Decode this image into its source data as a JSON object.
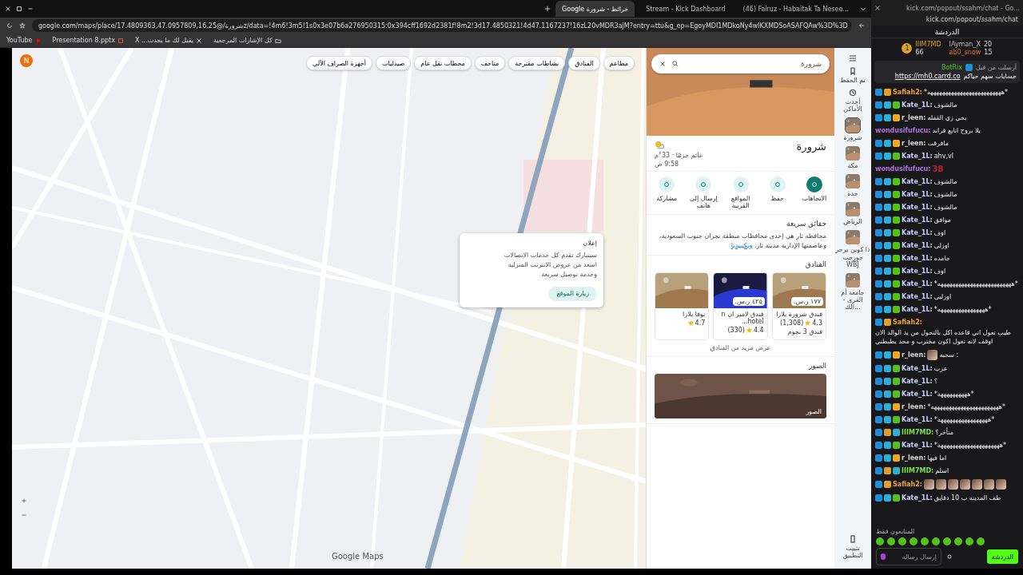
{
  "browser": {
    "active_tab": {
      "title": "Google خرائط - شرورة",
      "selected": true
    },
    "second_tab": {
      "title": "Stream - Kick Dashboard",
      "selected": false
    },
    "third_tab": {
      "title": "(46) Fairuz - Habaitak Ta Nesee...",
      "selected": false
    },
    "url": "google.com/maps/place/شرورة/@17.4809363,47.0957809,16.25z/data=!4m6!3m5!1s0x3e07b6a276950315:0x394cff1692d2381f!8m2!3d17.4850321!4d47.1167237!16zL20vMDR3ajM?entry=ttu&g_ep=EgoyMDI1MDkoNy4wIKXMDSoASAFQAw%3D%3D",
    "bookmarks": [
      {
        "title": "كل الإشارات المرجعية",
        "kind": "folder"
      },
      {
        "title": "يقبل لك ما يحدث... X",
        "kind": "x"
      },
      {
        "title": "Presentation 8.pptx",
        "kind": "ppt"
      },
      {
        "title": "YouTube",
        "kind": "yt"
      }
    ]
  },
  "map": {
    "avatar": "N",
    "chips": [
      {
        "label": "مطاعم"
      },
      {
        "label": "الفنادق"
      },
      {
        "label": "نشاطات مقترحة"
      },
      {
        "label": "متاحف"
      },
      {
        "label": "محطات نقل عام"
      },
      {
        "label": "صيدليات"
      },
      {
        "label": "أجهزة الصراف الآلي"
      }
    ],
    "ad": {
      "label": "إعلان",
      "lines": [
        "سيتبارك تقدم كل خدمات الاتصالات",
        "اسعد من عروض الانترنت المنزلية",
        "وخدمة توصيل سريعة"
      ],
      "button": "زيارة الموقع"
    },
    "logo": "Google Maps"
  },
  "panel": {
    "search": "شرورة",
    "title": "شرورة",
    "weather": {
      "condition": "غائم جزئيًا · 33°م",
      "time": "9:58 ص"
    },
    "actions": [
      {
        "label": "الاتجاهات",
        "selected": true
      },
      {
        "label": "حفظ",
        "selected": false
      },
      {
        "label": "المواقع القريبة",
        "selected": false
      },
      {
        "label": "إرسال إلى هاتف",
        "selected": false
      },
      {
        "label": "مشاركة",
        "selected": false
      }
    ],
    "facts": {
      "heading": "حقائق سريعة",
      "text": "محافظة ثار هي إحدى محافظات منطقة نجران جنوب السعودية، وعاصمتها الإدارية مدينة ثار.",
      "link": "ويكيبيديا"
    },
    "hotels": {
      "heading": "الفنادق",
      "items": [
        {
          "price": "١٧٧ ر.س.",
          "name": "فندق شرورة بلازا",
          "rating": "4.3",
          "reviews": "(1,308)",
          "class": "فندق 3 نجوم"
        },
        {
          "price": "٤٢٥ ر.س.",
          "name": "فندق لامير ان n hotel...",
          "rating": "4.4",
          "reviews": "(330)"
        },
        {
          "name": "نوفا بلازا",
          "rating": "4.7"
        }
      ],
      "more": "عرض مزيد من الفنادق"
    },
    "photos": {
      "heading": "الصور",
      "caption": "الصور"
    }
  },
  "rail": {
    "items": [
      {
        "kind": "saved",
        "label": "تم الحفظ"
      },
      {
        "kind": "recent",
        "label": "أحدث الأماكن"
      },
      {
        "kind": "thumb",
        "label": "شرورة",
        "selected": true
      },
      {
        "kind": "thumb",
        "label": "مكة",
        "selected": false
      },
      {
        "kind": "thumb",
        "label": "جدة",
        "selected": false
      },
      {
        "kind": "thumb",
        "label": "الرياض",
        "selected": false
      },
      {
        "kind": "thumb",
        "label": "ذا كوين برجر جورجت WBJ",
        "selected": false
      },
      {
        "kind": "thumb",
        "label": "جامعة أم القرى - الك...",
        "selected": false
      }
    ],
    "install": "تثبيت التطبيق"
  },
  "chat": {
    "window_title": "kick.com/popout/ssahm/chat - Go...",
    "url": "kick.com/popout/ssahm/chat",
    "header": "الدردشة",
    "top_gifter": {
      "rank": "1",
      "name": "IIIM7MD",
      "count": "66"
    },
    "gifters": [
      {
        "name": "IAyman_X",
        "count": "20"
      },
      {
        "name": "ab0_snow",
        "count": "15"
      }
    ],
    "pinned": {
      "sent_by": "أرسلت من قبل",
      "bot": "BotRix",
      "text": "حسابات سهم حياكم",
      "link": "https://mh0.carrd.co"
    },
    "messages": [
      {
        "user": "Safiah2:",
        "color": "#f0a030",
        "badges": [
          {
            "kind": "mod"
          },
          {
            "kind": "crown"
          }
        ],
        "parts": [
          {
            "kind": "text",
            "text": "*هههههههههههههههههههههههههه*"
          }
        ]
      },
      {
        "user": "Kate_1L:",
        "color": "#c8d0ff",
        "badges": [
          {
            "kind": "mod"
          },
          {
            "kind": "vip"
          },
          {
            "kind": "sub"
          }
        ],
        "parts": [
          {
            "kind": "text",
            "text": "مالشوف"
          }
        ]
      },
      {
        "user": "r_leen:",
        "color": "#d8d8d8",
        "badges": [
          {
            "kind": "mod"
          },
          {
            "kind": "vip"
          },
          {
            "kind": "one"
          }
        ],
        "parts": [
          {
            "kind": "text",
            "text": "بحي زي القفله"
          }
        ]
      },
      {
        "user": "wondusifufucu:",
        "color": "#b070e0",
        "parts": [
          {
            "kind": "text",
            "text": "يلا بروح اتابع قراند"
          }
        ]
      },
      {
        "user": "r_leen:",
        "color": "#d8d8d8",
        "badges": [
          {
            "kind": "mod"
          },
          {
            "kind": "vip"
          },
          {
            "kind": "one"
          }
        ],
        "parts": [
          {
            "kind": "text",
            "text": "مافرقت"
          }
        ]
      },
      {
        "user": "Kate_1L:",
        "color": "#c8d0ff",
        "badges": [
          {
            "kind": "mod"
          },
          {
            "kind": "vip"
          },
          {
            "kind": "sub"
          }
        ],
        "parts": [
          {
            "kind": "text",
            "text": "ahv,vl"
          }
        ]
      },
      {
        "user": "wondusifufucu:",
        "color": "#b070e0",
        "parts": [
          {
            "kind": "big",
            "text": "38"
          }
        ]
      },
      {
        "user": "Kate_1L:",
        "color": "#c8d0ff",
        "badges": [
          {
            "kind": "mod"
          },
          {
            "kind": "vip"
          },
          {
            "kind": "sub"
          }
        ],
        "parts": [
          {
            "kind": "text",
            "text": "مالشوف"
          }
        ]
      },
      {
        "user": "Kate_1L:",
        "color": "#c8d0ff",
        "badges": [
          {
            "kind": "mod"
          },
          {
            "kind": "vip"
          },
          {
            "kind": "sub"
          }
        ],
        "parts": [
          {
            "kind": "text",
            "text": "مالشوف"
          }
        ]
      },
      {
        "user": "Kate_1L:",
        "color": "#c8d0ff",
        "badges": [
          {
            "kind": "mod"
          },
          {
            "kind": "vip"
          },
          {
            "kind": "sub"
          }
        ],
        "parts": [
          {
            "kind": "text",
            "text": "مالشوف"
          }
        ]
      },
      {
        "user": "Kate_1L:",
        "color": "#c8d0ff",
        "badges": [
          {
            "kind": "mod"
          },
          {
            "kind": "vip"
          },
          {
            "kind": "sub"
          }
        ],
        "parts": [
          {
            "kind": "text",
            "text": "موافق"
          }
        ]
      },
      {
        "user": "Kate_1L:",
        "color": "#c8d0ff",
        "badges": [
          {
            "kind": "mod"
          },
          {
            "kind": "vip"
          },
          {
            "kind": "sub"
          }
        ],
        "parts": [
          {
            "kind": "text",
            "text": "اوف"
          }
        ]
      },
      {
        "user": "Kate_1L:",
        "color": "#c8d0ff",
        "badges": [
          {
            "kind": "mod"
          },
          {
            "kind": "vip"
          },
          {
            "kind": "sub"
          }
        ],
        "parts": [
          {
            "kind": "text",
            "text": "اوزلي"
          }
        ]
      },
      {
        "user": "Kate_1L:",
        "color": "#c8d0ff",
        "badges": [
          {
            "kind": "mod"
          },
          {
            "kind": "vip"
          },
          {
            "kind": "sub"
          }
        ],
        "parts": [
          {
            "kind": "text",
            "text": "جامده"
          }
        ]
      },
      {
        "user": "Kate_1L:",
        "color": "#c8d0ff",
        "badges": [
          {
            "kind": "mod"
          },
          {
            "kind": "vip"
          },
          {
            "kind": "sub"
          }
        ],
        "parts": [
          {
            "kind": "text",
            "text": "اوف"
          }
        ]
      },
      {
        "user": "Kate_1L:",
        "color": "#c8d0ff",
        "badges": [
          {
            "kind": "mod"
          },
          {
            "kind": "vip"
          },
          {
            "kind": "sub"
          }
        ],
        "parts": [
          {
            "kind": "text",
            "text": "*هههههههههههههههههههههههههه*"
          }
        ]
      },
      {
        "user": "Kate_1L:",
        "color": "#c8d0ff",
        "badges": [
          {
            "kind": "mod"
          },
          {
            "kind": "vip"
          },
          {
            "kind": "sub"
          }
        ],
        "parts": [
          {
            "kind": "text",
            "text": "اوزلبي"
          }
        ]
      },
      {
        "user": "Kate_1L:",
        "color": "#c8d0ff",
        "badges": [
          {
            "kind": "mod"
          },
          {
            "kind": "vip"
          },
          {
            "kind": "sub"
          }
        ],
        "parts": [
          {
            "kind": "text",
            "text": "*ههههههههههههههههه*"
          }
        ]
      },
      {
        "user": "Safiah2:",
        "color": "#f0a030",
        "badges": [
          {
            "kind": "mod"
          },
          {
            "kind": "crown"
          }
        ],
        "parts": [
          {
            "kind": "text",
            "text": "طيب تعول اني قاعده اكل بالتحول من يد الوالد الان اوقف لانه تعول اكون مخترب و محد يطبطني"
          }
        ]
      },
      {
        "user": "r_leen:",
        "color": "#d8d8d8",
        "badges": [
          {
            "kind": "mod"
          },
          {
            "kind": "vip"
          },
          {
            "kind": "one"
          }
        ],
        "parts": [
          {
            "kind": "emote"
          },
          {
            "kind": "text",
            "text": "سحبه :"
          }
        ]
      },
      {
        "user": "Kate_1L:",
        "color": "#c8d0ff",
        "badges": [
          {
            "kind": "mod"
          },
          {
            "kind": "vip"
          },
          {
            "kind": "sub"
          }
        ],
        "parts": [
          {
            "kind": "text",
            "text": "عزب"
          }
        ]
      },
      {
        "user": "Kate_1L:",
        "color": "#c8d0ff",
        "badges": [
          {
            "kind": "mod"
          },
          {
            "kind": "vip"
          },
          {
            "kind": "sub"
          }
        ],
        "parts": [
          {
            "kind": "text",
            "text": "؟"
          }
        ]
      },
      {
        "user": "Kate_1L:",
        "color": "#c8d0ff",
        "badges": [
          {
            "kind": "mod"
          },
          {
            "kind": "vip"
          },
          {
            "kind": "sub"
          }
        ],
        "parts": [
          {
            "kind": "text",
            "text": "*ههههههههههه*"
          }
        ]
      },
      {
        "user": "r_leen:",
        "color": "#d8d8d8",
        "badges": [
          {
            "kind": "mod"
          },
          {
            "kind": "vip"
          },
          {
            "kind": "one"
          }
        ],
        "parts": [
          {
            "kind": "text",
            "text": "*هههههههههههههههههههههههه*"
          }
        ]
      },
      {
        "user": "Kate_1L:",
        "color": "#c8d0ff",
        "badges": [
          {
            "kind": "mod"
          },
          {
            "kind": "vip"
          },
          {
            "kind": "sub"
          }
        ],
        "parts": [
          {
            "kind": "text",
            "text": "*هههههههههههههههههه*"
          }
        ]
      },
      {
        "user": "IIIM7MD:",
        "color": "#7ee04a",
        "badges": [
          {
            "kind": "mod"
          },
          {
            "kind": "crown"
          },
          {
            "kind": "vip"
          }
        ],
        "parts": [
          {
            "kind": "text",
            "text": "متأخر؟"
          }
        ]
      },
      {
        "user": "Kate_1L:",
        "color": "#c8d0ff",
        "badges": [
          {
            "kind": "mod"
          },
          {
            "kind": "vip"
          },
          {
            "kind": "sub"
          }
        ],
        "parts": [
          {
            "kind": "text",
            "text": "*هههههههههههههههههههههه*"
          }
        ]
      },
      {
        "user": "r_leen:",
        "color": "#d8d8d8",
        "badges": [
          {
            "kind": "mod"
          },
          {
            "kind": "vip"
          },
          {
            "kind": "one"
          }
        ],
        "parts": [
          {
            "kind": "text",
            "text": "اما فيها"
          }
        ]
      },
      {
        "user": "IIIM7MD:",
        "color": "#7ee04a",
        "badges": [
          {
            "kind": "mod"
          },
          {
            "kind": "crown"
          },
          {
            "kind": "vip"
          }
        ],
        "parts": [
          {
            "kind": "text",
            "text": "اسلم"
          }
        ]
      },
      {
        "user": "Safiah2:",
        "color": "#f0a030",
        "badges": [
          {
            "kind": "mod"
          },
          {
            "kind": "crown"
          }
        ],
        "parts": [
          {
            "kind": "emote"
          },
          {
            "kind": "emote"
          },
          {
            "kind": "emote"
          },
          {
            "kind": "emote"
          },
          {
            "kind": "emote"
          },
          {
            "kind": "emote"
          },
          {
            "kind": "emote"
          }
        ]
      },
      {
        "user": "Kate_1L:",
        "color": "#c8d0ff",
        "badges": [
          {
            "kind": "mod"
          },
          {
            "kind": "vip"
          },
          {
            "kind": "sub"
          }
        ],
        "parts": [
          {
            "kind": "text",
            "text": "طف المدينه ب 10 دقايق"
          }
        ]
      }
    ],
    "followers_only": "المتابعون فقط",
    "input_placeholder": "إرسال رسالة",
    "send_button": "الدردشة"
  }
}
